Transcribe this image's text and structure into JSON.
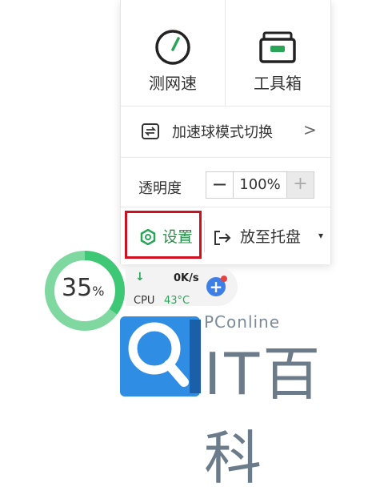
{
  "panel": {
    "speed_test_label": "测网速",
    "toolbox_label": "工具箱",
    "mode_switch_label": "加速球模式切换",
    "opacity_label": "透明度",
    "opacity_value": "100%",
    "minus": "−",
    "plus": "+",
    "settings_label": "设置",
    "tray_label": "放至托盘",
    "tray_arrow": "▾",
    "chevron": ">"
  },
  "ball": {
    "percent": "35",
    "percent_unit": "%",
    "down_arrow": "↓",
    "speed": "0K/s",
    "cpu_label": "CPU",
    "cpu_temp": "43°C",
    "plus": "+"
  },
  "watermark": {
    "brand": "PConline",
    "text": "IT百科"
  },
  "colors": {
    "accent_green": "#2aa558",
    "highlight_red": "#d0101f",
    "blue": "#3d7fe6"
  }
}
